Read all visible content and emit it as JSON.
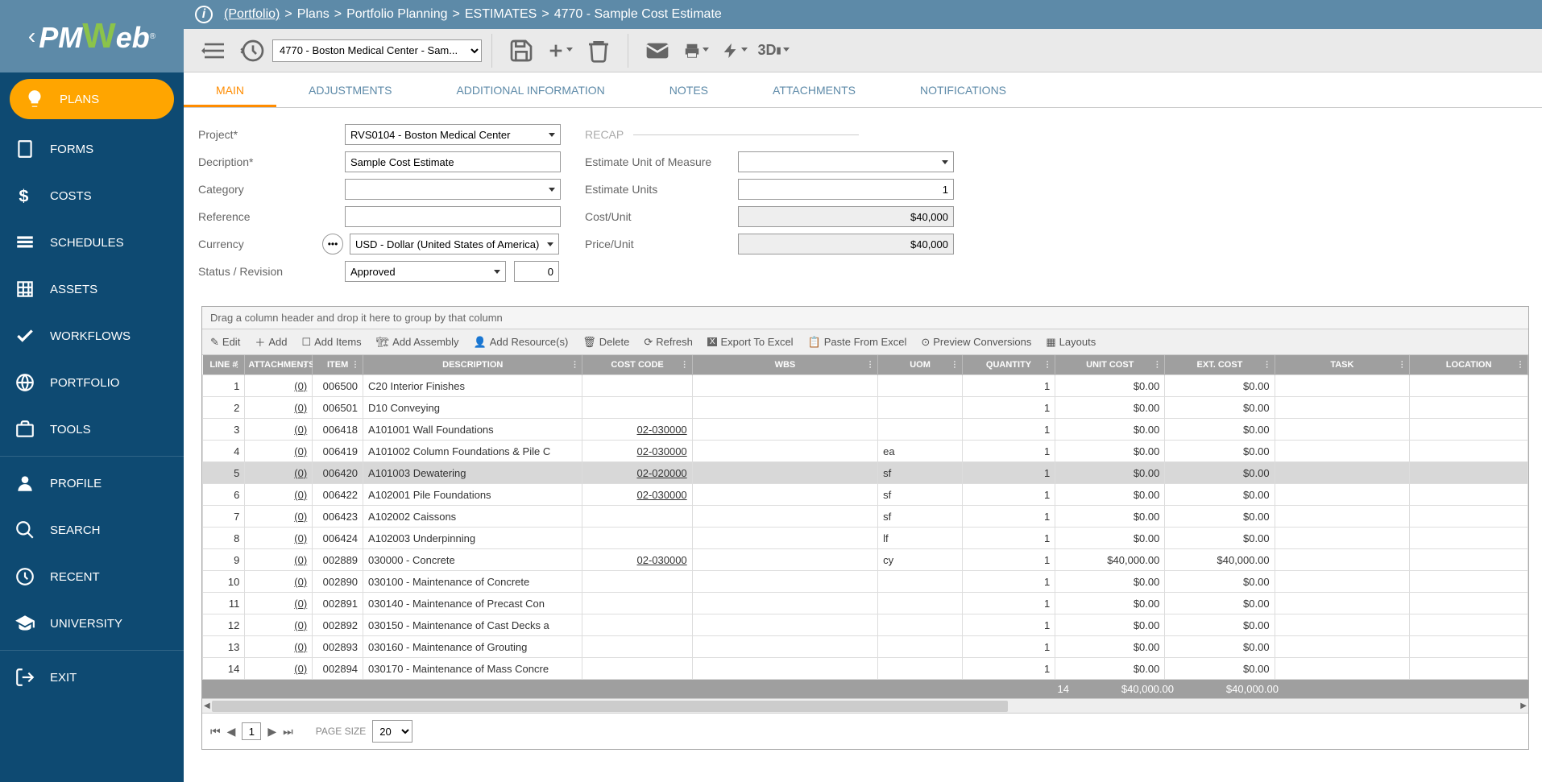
{
  "breadcrumb": {
    "portfolio": "(Portfolio)",
    "parts": [
      "Plans",
      "Portfolio Planning",
      "ESTIMATES",
      "4770 - Sample Cost Estimate"
    ]
  },
  "toolbar": {
    "record_select": "4770 - Boston Medical Center - Sam..."
  },
  "sidebar": {
    "items": [
      {
        "label": "PLANS",
        "icon": "bulb"
      },
      {
        "label": "FORMS",
        "icon": "doc"
      },
      {
        "label": "COSTS",
        "icon": "dollar"
      },
      {
        "label": "SCHEDULES",
        "icon": "rows"
      },
      {
        "label": "ASSETS",
        "icon": "grid"
      },
      {
        "label": "WORKFLOWS",
        "icon": "check"
      },
      {
        "label": "PORTFOLIO",
        "icon": "globe"
      },
      {
        "label": "TOOLS",
        "icon": "briefcase"
      }
    ],
    "items2": [
      {
        "label": "PROFILE",
        "icon": "user"
      },
      {
        "label": "SEARCH",
        "icon": "search"
      },
      {
        "label": "RECENT",
        "icon": "history"
      },
      {
        "label": "UNIVERSITY",
        "icon": "grad"
      }
    ],
    "exit": "EXIT"
  },
  "tabs": [
    "MAIN",
    "ADJUSTMENTS",
    "ADDITIONAL INFORMATION",
    "NOTES",
    "ATTACHMENTS",
    "NOTIFICATIONS"
  ],
  "form": {
    "labels": {
      "project": "Project*",
      "description": "Decription*",
      "category": "Category",
      "reference": "Reference",
      "currency": "Currency",
      "status": "Status / Revision",
      "recap": "RECAP",
      "euom": "Estimate Unit of Measure",
      "eunits": "Estimate Units",
      "costunit": "Cost/Unit",
      "priceunit": "Price/Unit"
    },
    "values": {
      "project": "RVS0104 - Boston Medical Center",
      "description": "Sample Cost Estimate",
      "category": "",
      "reference": "",
      "currency": "USD - Dollar (United States of America)",
      "status": "Approved",
      "revision": "0",
      "euom": "",
      "eunits": "1",
      "costunit": "$40,000",
      "priceunit": "$40,000"
    }
  },
  "grid": {
    "group_hint": "Drag a column header and drop it here to group by that column",
    "toolbar": {
      "edit": "Edit",
      "add": "Add",
      "add_items": "Add Items",
      "add_assembly": "Add Assembly",
      "add_resources": "Add Resource(s)",
      "delete": "Delete",
      "refresh": "Refresh",
      "export": "Export To Excel",
      "paste": "Paste From Excel",
      "preview": "Preview Conversions",
      "layouts": "Layouts"
    },
    "columns": [
      "LINE #",
      "ATTACHMENTS",
      "ITEM",
      "DESCRIPTION",
      "COST CODE",
      "WBS",
      "UOM",
      "QUANTITY",
      "UNIT COST",
      "EXT. COST",
      "TASK",
      "LOCATION"
    ],
    "rows": [
      {
        "line": "1",
        "att": "(0)",
        "item": "006500",
        "desc": "C20 Interior Finishes",
        "code": "",
        "wbs": "",
        "uom": "",
        "qty": "1",
        "ucost": "$0.00",
        "ecost": "$0.00",
        "task": "",
        "loc": ""
      },
      {
        "line": "2",
        "att": "(0)",
        "item": "006501",
        "desc": "D10 Conveying",
        "code": "",
        "wbs": "",
        "uom": "",
        "qty": "1",
        "ucost": "$0.00",
        "ecost": "$0.00",
        "task": "",
        "loc": ""
      },
      {
        "line": "3",
        "att": "(0)",
        "item": "006418",
        "desc": "A101001 Wall Foundations",
        "code": "02-030000",
        "wbs": "",
        "uom": "",
        "qty": "1",
        "ucost": "$0.00",
        "ecost": "$0.00",
        "task": "",
        "loc": ""
      },
      {
        "line": "4",
        "att": "(0)",
        "item": "006419",
        "desc": "A101002 Column Foundations & Pile C",
        "code": "02-030000",
        "wbs": "",
        "uom": "ea",
        "qty": "1",
        "ucost": "$0.00",
        "ecost": "$0.00",
        "task": "",
        "loc": ""
      },
      {
        "line": "5",
        "att": "(0)",
        "item": "006420",
        "desc": "A101003 Dewatering",
        "code": "02-020000",
        "wbs": "",
        "uom": "sf",
        "qty": "1",
        "ucost": "$0.00",
        "ecost": "$0.00",
        "task": "",
        "loc": "",
        "sel": true
      },
      {
        "line": "6",
        "att": "(0)",
        "item": "006422",
        "desc": "A102001 Pile Foundations",
        "code": "02-030000",
        "wbs": "",
        "uom": "sf",
        "qty": "1",
        "ucost": "$0.00",
        "ecost": "$0.00",
        "task": "",
        "loc": ""
      },
      {
        "line": "7",
        "att": "(0)",
        "item": "006423",
        "desc": "A102002 Caissons",
        "code": "",
        "wbs": "",
        "uom": "sf",
        "qty": "1",
        "ucost": "$0.00",
        "ecost": "$0.00",
        "task": "",
        "loc": ""
      },
      {
        "line": "8",
        "att": "(0)",
        "item": "006424",
        "desc": "A102003 Underpinning",
        "code": "",
        "wbs": "",
        "uom": "lf",
        "qty": "1",
        "ucost": "$0.00",
        "ecost": "$0.00",
        "task": "",
        "loc": ""
      },
      {
        "line": "9",
        "att": "(0)",
        "item": "002889",
        "desc": "030000 - Concrete",
        "code": "02-030000",
        "wbs": "",
        "uom": "cy",
        "qty": "1",
        "ucost": "$40,000.00",
        "ecost": "$40,000.00",
        "task": "",
        "loc": ""
      },
      {
        "line": "10",
        "att": "(0)",
        "item": "002890",
        "desc": "030100 - Maintenance of Concrete",
        "code": "",
        "wbs": "",
        "uom": "",
        "qty": "1",
        "ucost": "$0.00",
        "ecost": "$0.00",
        "task": "",
        "loc": ""
      },
      {
        "line": "11",
        "att": "(0)",
        "item": "002891",
        "desc": "030140 - Maintenance of Precast Con",
        "code": "",
        "wbs": "",
        "uom": "",
        "qty": "1",
        "ucost": "$0.00",
        "ecost": "$0.00",
        "task": "",
        "loc": ""
      },
      {
        "line": "12",
        "att": "(0)",
        "item": "002892",
        "desc": "030150 - Maintenance of Cast Decks a",
        "code": "",
        "wbs": "",
        "uom": "",
        "qty": "1",
        "ucost": "$0.00",
        "ecost": "$0.00",
        "task": "",
        "loc": ""
      },
      {
        "line": "13",
        "att": "(0)",
        "item": "002893",
        "desc": "030160 - Maintenance of Grouting",
        "code": "",
        "wbs": "",
        "uom": "",
        "qty": "1",
        "ucost": "$0.00",
        "ecost": "$0.00",
        "task": "",
        "loc": ""
      },
      {
        "line": "14",
        "att": "(0)",
        "item": "002894",
        "desc": "030170 - Maintenance of Mass Concre",
        "code": "",
        "wbs": "",
        "uom": "",
        "qty": "1",
        "ucost": "$0.00",
        "ecost": "$0.00",
        "task": "",
        "loc": ""
      }
    ],
    "footer": {
      "qty": "14",
      "ucost": "$40,000.00",
      "ecost": "$40,000.00"
    },
    "pager": {
      "label": "PAGE SIZE",
      "page": "1",
      "size": "20"
    }
  }
}
